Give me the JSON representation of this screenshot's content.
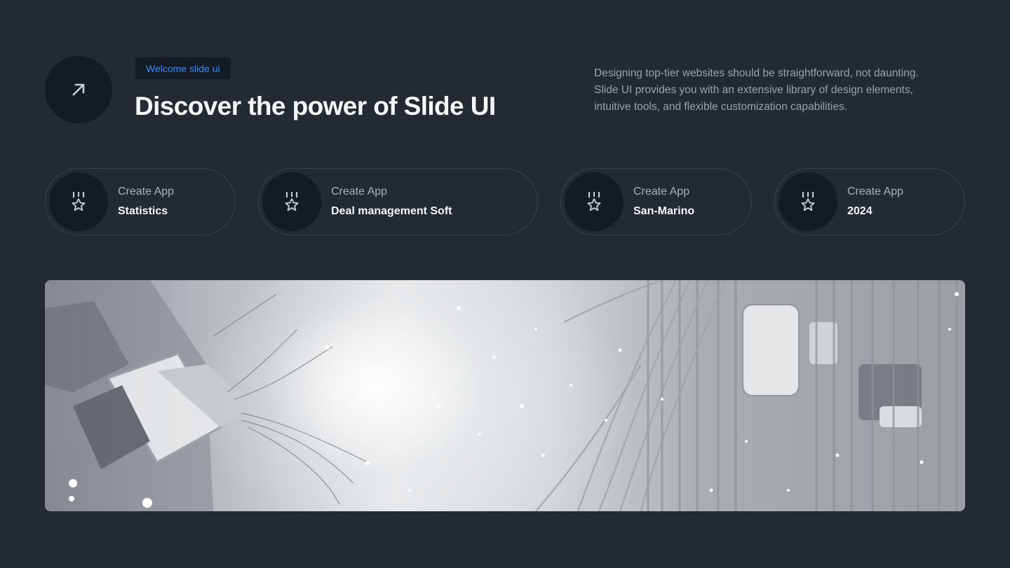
{
  "header": {
    "badge": "Welcome slide ui",
    "title": "Discover the power of Slide UI",
    "description_lines": [
      "Designing top-tier websites should be straightforward, not daunting.",
      "Slide UI provides you with an extensive library of design elements,",
      "intuitive tools, and flexible customization capabilities."
    ],
    "hero_icon": "arrow-up-right-icon"
  },
  "cards": [
    {
      "label": "Create App",
      "value": "Statistics",
      "icon": "medal-star-icon"
    },
    {
      "label": "Create App",
      "value": "Deal management Soft",
      "icon": "medal-star-icon"
    },
    {
      "label": "Create App",
      "value": "San-Marino",
      "icon": "medal-star-icon"
    },
    {
      "label": "Create App",
      "value": "2024",
      "icon": "medal-star-icon"
    }
  ],
  "colors": {
    "background": "#242a31",
    "icon_circle": "#141b24",
    "badge_text": "#3d8bf2",
    "card_border": "#3b434d"
  }
}
